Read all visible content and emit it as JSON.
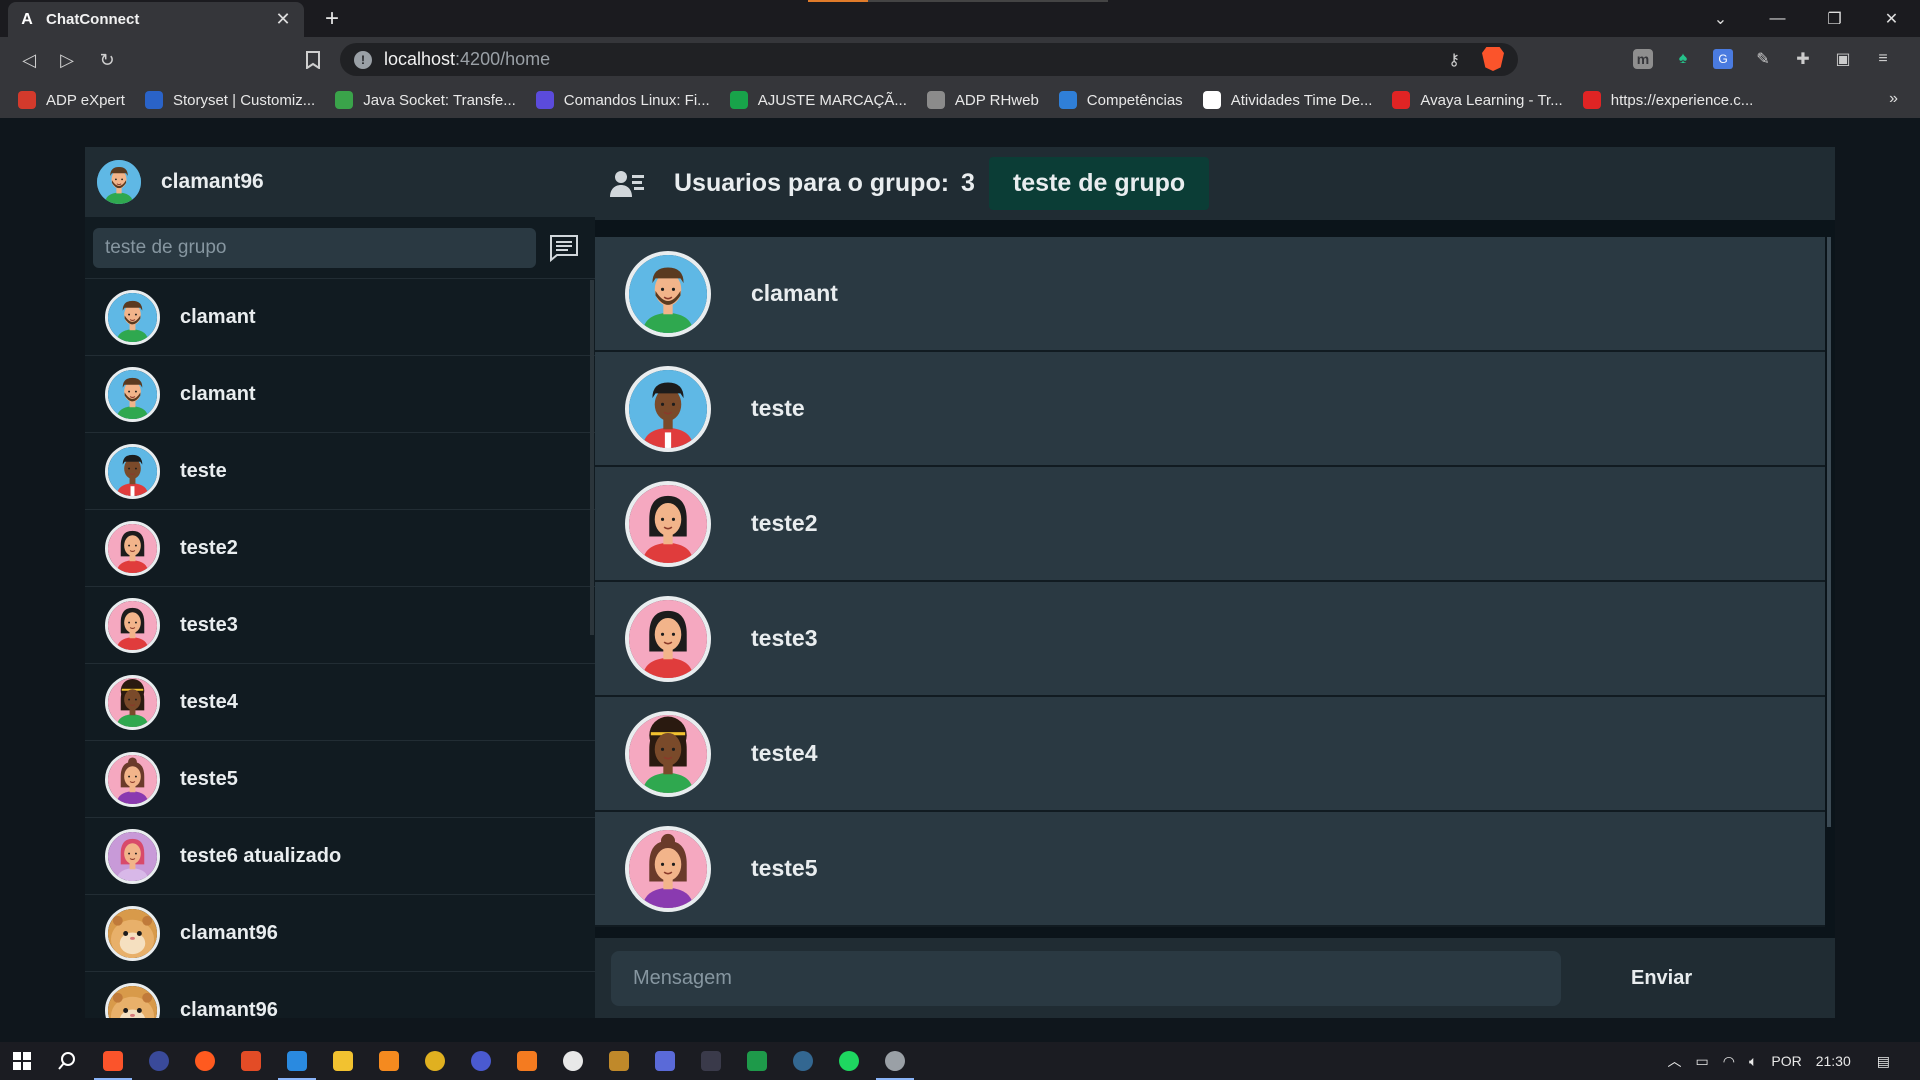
{
  "browser": {
    "tab_title": "ChatConnect",
    "tab_favicon": "A",
    "new_tab": "+",
    "url_host": "localhost",
    "url_path": ":4200/home",
    "bookmarks": [
      {
        "label": "ADP eXpert",
        "color": "#d33a2c"
      },
      {
        "label": "Storyset | Customiz...",
        "color": "#2a63c8"
      },
      {
        "label": "Java Socket: Transfe...",
        "color": "#3aa34a"
      },
      {
        "label": "Comandos Linux: Fi...",
        "color": "#5b4bdb"
      },
      {
        "label": "AJUSTE MARCAÇÃ...",
        "color": "#18a34a"
      },
      {
        "label": "ADP RHweb",
        "color": "#8b8b8b"
      },
      {
        "label": "Competências",
        "color": "#2f7fd8"
      },
      {
        "label": "Atividades Time De...",
        "color": "#ffffff"
      },
      {
        "label": "Avaya Learning - Tr...",
        "color": "#e02424"
      },
      {
        "label": "https://experience.c...",
        "color": "#e02424"
      }
    ],
    "bookmarks_more": "»"
  },
  "sidebar": {
    "current_user": "clamant96",
    "search_placeholder": "teste de grupo",
    "contacts": [
      {
        "name": "clamant",
        "avatar": "man-beard"
      },
      {
        "name": "clamant",
        "avatar": "man-beard"
      },
      {
        "name": "teste",
        "avatar": "man-dark"
      },
      {
        "name": "teste2",
        "avatar": "woman-dark-hair"
      },
      {
        "name": "teste3",
        "avatar": "woman-dark-hair"
      },
      {
        "name": "teste4",
        "avatar": "woman-curly"
      },
      {
        "name": "teste5",
        "avatar": "woman-bun"
      },
      {
        "name": "teste6 atualizado",
        "avatar": "woman-red"
      },
      {
        "name": "clamant96",
        "avatar": "hamster"
      },
      {
        "name": "clamant96",
        "avatar": "hamster"
      }
    ]
  },
  "main": {
    "header_label": "Usuarios para o grupo:",
    "member_count": "3",
    "group_name": "teste de grupo",
    "members": [
      {
        "name": "clamant",
        "avatar": "man-beard"
      },
      {
        "name": "teste",
        "avatar": "man-dark"
      },
      {
        "name": "teste2",
        "avatar": "woman-dark-hair"
      },
      {
        "name": "teste3",
        "avatar": "woman-dark-hair"
      },
      {
        "name": "teste4",
        "avatar": "woman-curly"
      },
      {
        "name": "teste5",
        "avatar": "woman-bun"
      }
    ],
    "message_placeholder": "Mensagem",
    "send_label": "Enviar"
  },
  "taskbar": {
    "language": "POR",
    "time": "21:30"
  },
  "colors": {
    "sidebar_bg": "#111b21",
    "header_bg": "#202c33",
    "member_bg": "#2a3942",
    "group_badge": "#0b3d36"
  }
}
